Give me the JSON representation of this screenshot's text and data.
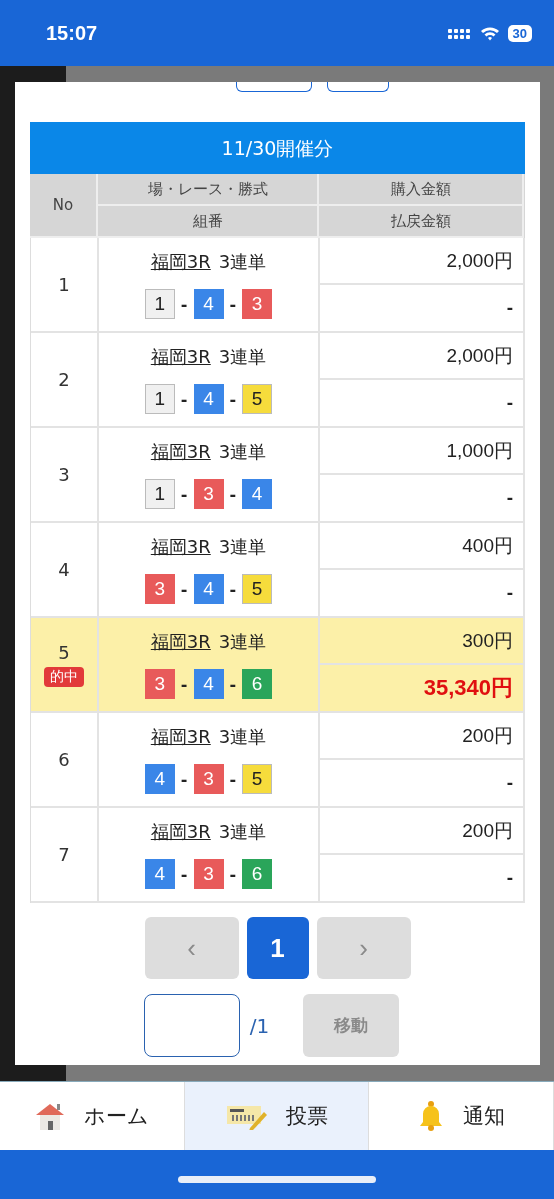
{
  "status_bar": {
    "time": "15:07",
    "battery": "30"
  },
  "table": {
    "title": "11/30開催分",
    "columns": {
      "no": "No",
      "race": "場・レース・勝式",
      "combo": "組番",
      "purchase": "購入金額",
      "payout": "払戻金額"
    },
    "rows": [
      {
        "no": "1",
        "venue": "福岡3R",
        "bet_type": "3連単",
        "balls": [
          {
            "number": "1",
            "color": "#f0f0f0"
          },
          {
            "dash": "-",
            "number": "4",
            "color": "#3a86e8"
          },
          {
            "dash": "-",
            "number": "3",
            "color": "#e85a5a"
          }
        ],
        "purchase": "2,000円",
        "payout": "-",
        "hit": false
      },
      {
        "no": "2",
        "venue": "福岡3R",
        "bet_type": "3連単",
        "balls": [
          {
            "number": "1",
            "color": "#f0f0f0"
          },
          {
            "dash": "-",
            "number": "4",
            "color": "#3a86e8"
          },
          {
            "dash": "-",
            "number": "5",
            "color": "#f6dc3c"
          }
        ],
        "purchase": "2,000円",
        "payout": "-",
        "hit": false
      },
      {
        "no": "3",
        "venue": "福岡3R",
        "bet_type": "3連単",
        "balls": [
          {
            "number": "1",
            "color": "#f0f0f0"
          },
          {
            "dash": "-",
            "number": "3",
            "color": "#e85a5a"
          },
          {
            "dash": "-",
            "number": "4",
            "color": "#3a86e8"
          }
        ],
        "purchase": "1,000円",
        "payout": "-",
        "hit": false
      },
      {
        "no": "4",
        "venue": "福岡3R",
        "bet_type": "3連単",
        "balls": [
          {
            "number": "3",
            "color": "#e85a5a"
          },
          {
            "dash": "-",
            "number": "4",
            "color": "#3a86e8"
          },
          {
            "dash": "-",
            "number": "5",
            "color": "#f6dc3c"
          }
        ],
        "purchase": "400円",
        "payout": "-",
        "hit": false
      },
      {
        "no": "5",
        "badge": "的中",
        "venue": "福岡3R",
        "bet_type": "3連単",
        "balls": [
          {
            "number": "3",
            "color": "#e85a5a"
          },
          {
            "dash": "-",
            "number": "4",
            "color": "#3a86e8"
          },
          {
            "dash": "-",
            "number": "6",
            "color": "#2aa55a"
          }
        ],
        "purchase": "300円",
        "payout": "35,340円",
        "hit": true
      },
      {
        "no": "6",
        "venue": "福岡3R",
        "bet_type": "3連単",
        "balls": [
          {
            "number": "4",
            "color": "#3a86e8"
          },
          {
            "dash": "-",
            "number": "3",
            "color": "#e85a5a"
          },
          {
            "dash": "-",
            "number": "5",
            "color": "#f6dc3c"
          }
        ],
        "purchase": "200円",
        "payout": "-",
        "hit": false
      },
      {
        "no": "7",
        "venue": "福岡3R",
        "bet_type": "3連単",
        "balls": [
          {
            "number": "4",
            "color": "#3a86e8"
          },
          {
            "dash": "-",
            "number": "3",
            "color": "#e85a5a"
          },
          {
            "dash": "-",
            "number": "6",
            "color": "#2aa55a"
          }
        ],
        "purchase": "200円",
        "payout": "-",
        "hit": false
      }
    ]
  },
  "pagination": {
    "prev": {
      "label": "‹",
      "disabled": true
    },
    "pages": [
      {
        "label": "1",
        "selected": true
      }
    ],
    "next": {
      "label": "›",
      "disabled": true
    },
    "total": "/1",
    "go_button": {
      "label": "移動",
      "disabled": true
    }
  },
  "bottom_nav": [
    {
      "kind": "home",
      "label": "ホーム",
      "selected": false
    },
    {
      "kind": "ballot",
      "label": "投票",
      "selected": true
    },
    {
      "kind": "bell",
      "label": "通知",
      "selected": false
    }
  ]
}
